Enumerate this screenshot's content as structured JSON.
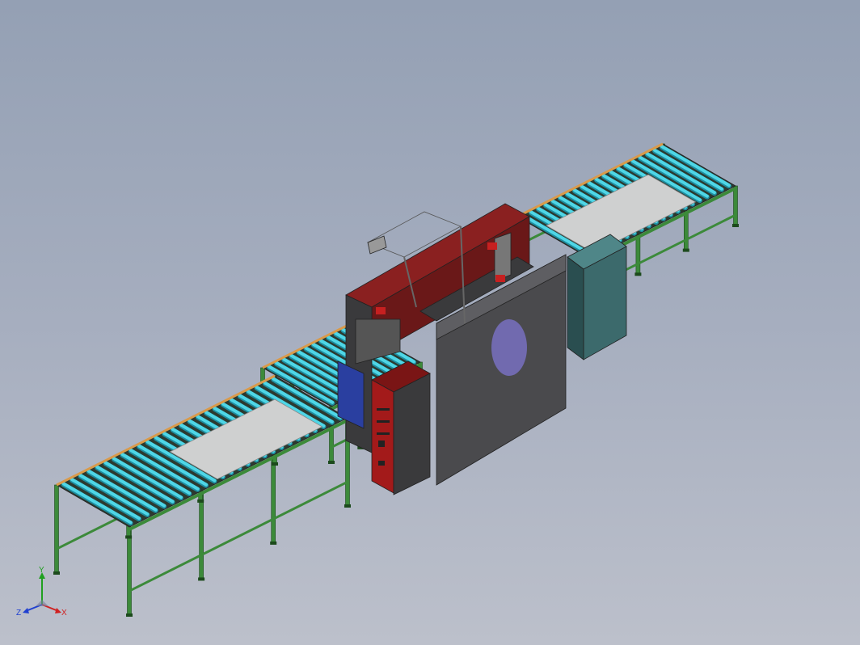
{
  "viewport": {
    "background_top": "#94a0b4",
    "background_bottom": "#bcc0cb"
  },
  "colors": {
    "roller": "#4fd6e6",
    "roller_dark": "#1f8ea0",
    "frame_green": "#3c8a3a",
    "frame_edge": "#1c4a1c",
    "side_rail_orange": "#d99a4a",
    "plate_gray": "#cfd0d0",
    "machine_red": "#8a2020",
    "machine_gray": "#4a4a4d",
    "control_cabinet_red": "#a31a1a",
    "blue_panel": "#2a3fa0",
    "teal_cabinet": "#3c6a6c"
  },
  "model": {
    "components": [
      "left-infeed-conveyor",
      "middle-conveyor",
      "outfeed-conveyor",
      "saw-machine-frame",
      "control-cabinet",
      "electrical-cabinet",
      "overhead-guard-arm"
    ]
  },
  "triad": {
    "x_label": "X",
    "y_label": "Y",
    "z_label": "Z",
    "x_color": "#d02020",
    "y_color": "#20a020",
    "z_color": "#2040d0"
  }
}
